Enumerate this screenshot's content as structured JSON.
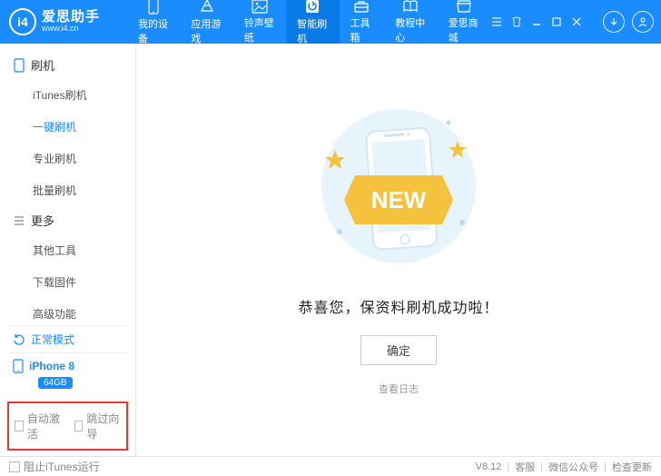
{
  "brand": {
    "logo_text": "i4",
    "title": "爱思助手",
    "subtitle": "www.i4.cn"
  },
  "topnav": [
    {
      "label": "我的设备"
    },
    {
      "label": "应用游戏"
    },
    {
      "label": "铃声壁纸"
    },
    {
      "label": "智能刷机"
    },
    {
      "label": "工具箱"
    },
    {
      "label": "教程中心"
    },
    {
      "label": "爱思商城"
    }
  ],
  "sidebar": {
    "sec1": {
      "title": "刷机",
      "items": [
        "iTunes刷机",
        "一键刷机",
        "专业刷机",
        "批量刷机"
      ]
    },
    "sec2": {
      "title": "更多",
      "items": [
        "其他工具",
        "下载固件",
        "高级功能"
      ]
    },
    "mode": "正常模式",
    "device": {
      "name": "iPhone 8",
      "storage": "64GB"
    },
    "check1": "自动激活",
    "check2": "跳过向导"
  },
  "content": {
    "new_badge": "NEW",
    "congrats": "恭喜您，保资料刷机成功啦！",
    "ok": "确定",
    "log": "查看日志"
  },
  "statusbar": {
    "block_itunes": "阻止iTunes运行",
    "version": "V8.12",
    "support": "客服",
    "wechat": "微信公众号",
    "update": "检查更新"
  }
}
